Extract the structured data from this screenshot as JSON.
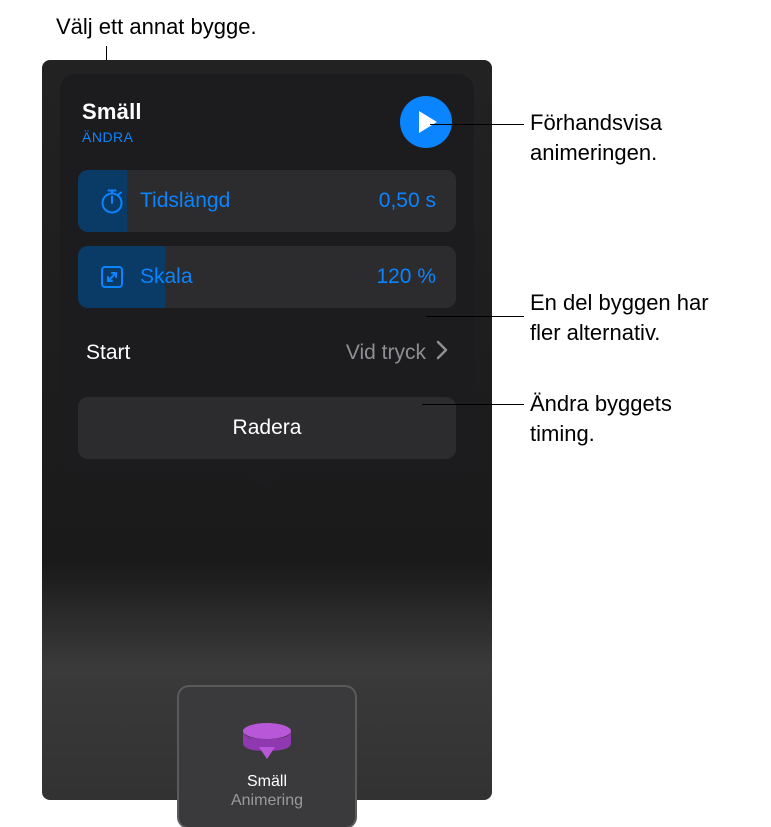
{
  "callouts": {
    "top": "Välj ett annat bygge.",
    "preview": {
      "line1": "Förhandsvisa",
      "line2": "animeringen."
    },
    "options": {
      "line1": "En del byggen har",
      "line2": "fler alternativ."
    },
    "timing": {
      "line1": "Ändra byggets",
      "line2": "timing."
    }
  },
  "panel": {
    "title": "Smäll",
    "change_label": "ÄNDRA",
    "duration": {
      "label": "Tidslängd",
      "value": "0,50 s"
    },
    "scale": {
      "label": "Skala",
      "value": "120 %"
    },
    "start": {
      "label": "Start",
      "value": "Vid tryck"
    },
    "delete_label": "Radera"
  },
  "thumbnail": {
    "title": "Smäll",
    "subtitle": "Animering"
  },
  "colors": {
    "accent": "#0a84ff",
    "purple": "#b858d8"
  }
}
